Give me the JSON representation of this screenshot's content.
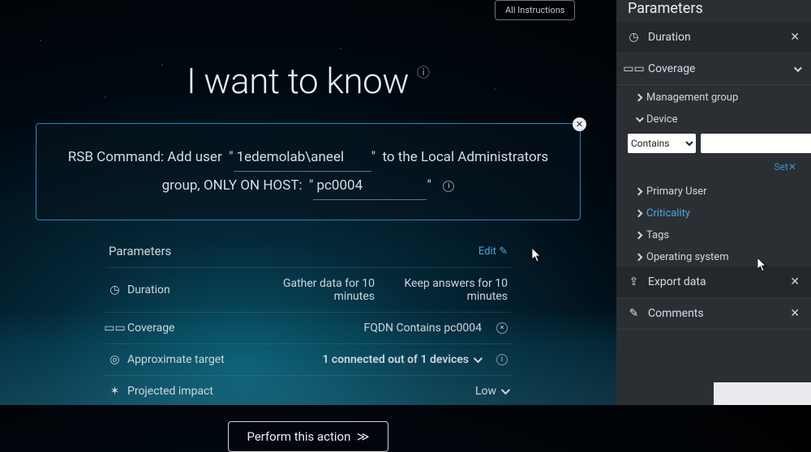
{
  "top_button": "All Instructions",
  "title": "I want to know",
  "command": {
    "prefix": "RSB Command: Add user",
    "user_value": "1edemolab\\aneel",
    "mid": "to the Local Administrators group, ONLY ON HOST:",
    "host_value": "pc0004"
  },
  "params": {
    "header": "Parameters",
    "edit_label": "Edit",
    "rows": {
      "duration": {
        "label": "Duration",
        "v1": "Gather data for 10 minutes",
        "v2": "Keep answers for 10 minutes"
      },
      "coverage": {
        "label": "Coverage",
        "value": "FQDN Contains pc0004"
      },
      "approx": {
        "label": "Approximate target",
        "value": "1 connected out of 1 devices"
      },
      "impact": {
        "label": "Projected impact",
        "value": "Low"
      }
    }
  },
  "perform_label": "Perform this action",
  "side": {
    "header": "Parameters",
    "duration": "Duration",
    "coverage": "Coverage",
    "mgmt": "Management group",
    "device": "Device",
    "filter_op": "Contains",
    "set": "Set",
    "primary": "Primary User",
    "criticality": "Criticality",
    "tags": "Tags",
    "os": "Operating system",
    "export": "Export data",
    "comments": "Comments"
  }
}
